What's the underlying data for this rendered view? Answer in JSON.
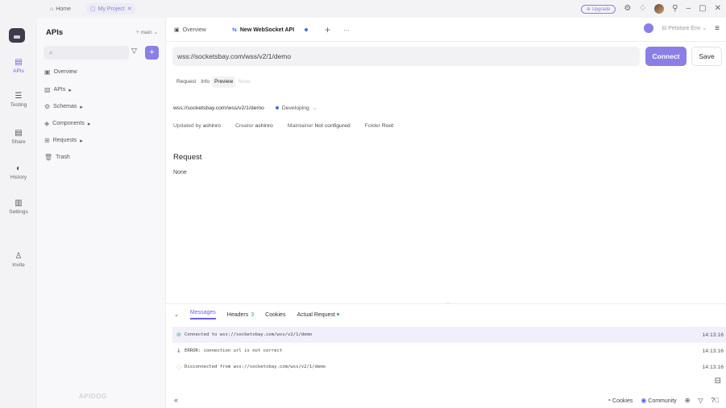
{
  "titlebar": {
    "home_label": "Home",
    "project_label": "My Project",
    "upgrade_label": "Upgrade"
  },
  "appnav": {
    "items": [
      {
        "label": "APIs",
        "icon": "api-icon"
      },
      {
        "label": "Testing",
        "icon": "testing-icon"
      },
      {
        "label": "Share",
        "icon": "share-icon"
      },
      {
        "label": "History",
        "icon": "history-icon"
      },
      {
        "label": "Settings",
        "icon": "settings-icon"
      },
      {
        "label": "Invite",
        "icon": "invite-icon"
      }
    ]
  },
  "sidebar": {
    "title": "APIs",
    "branch": "main",
    "search_placeholder": "",
    "items": [
      {
        "label": "Overview"
      },
      {
        "label": "APIs"
      },
      {
        "label": "Schemas"
      },
      {
        "label": "Components"
      },
      {
        "label": "Requests"
      },
      {
        "label": "Trash"
      }
    ],
    "footer_logo": "APIDOG"
  },
  "tabs": {
    "overview": "Overview",
    "active": "New WebSocket API",
    "env": "Petstore Env"
  },
  "request": {
    "url": "wss://socketsbay.com/wss/v2/1/demo",
    "connect_label": "Connect",
    "save_label": "Save",
    "subtabs": [
      "Request",
      "Info",
      "Preview",
      "None"
    ],
    "status": "Developing",
    "updated_by_label": "Updated by",
    "updated_by": "ashinro",
    "creator_label": "Creator",
    "creator": "ashinro",
    "maintainer_label": "Maintainer",
    "maintainer": "Not configured",
    "folder_label": "Folder",
    "folder": "Root",
    "section_title": "Request",
    "section_value": "None"
  },
  "panel": {
    "tabs": {
      "messages": "Messages",
      "headers": "Headers",
      "headers_count": "3",
      "cookies": "Cookies",
      "actual_request": "Actual Request"
    },
    "messages": [
      {
        "text": "Connected to wss://socketsbay.com/wss/v2/1/demo",
        "time": "14:13:16",
        "kind": "success"
      },
      {
        "text": "ERROR: connection url is not correct",
        "time": "14:13:16",
        "kind": "error"
      },
      {
        "text": "Disconnected from wss://socketsbay.com/wss/v2/1/demo",
        "time": "14:13:16",
        "kind": "warning"
      }
    ]
  },
  "footer": {
    "cookies": "Cookies",
    "community": "Community"
  },
  "colors": {
    "accent": "#8a7fe6",
    "success": "#3aa56b",
    "warning": "#f0a030",
    "status_dot": "#3b6fe0"
  }
}
